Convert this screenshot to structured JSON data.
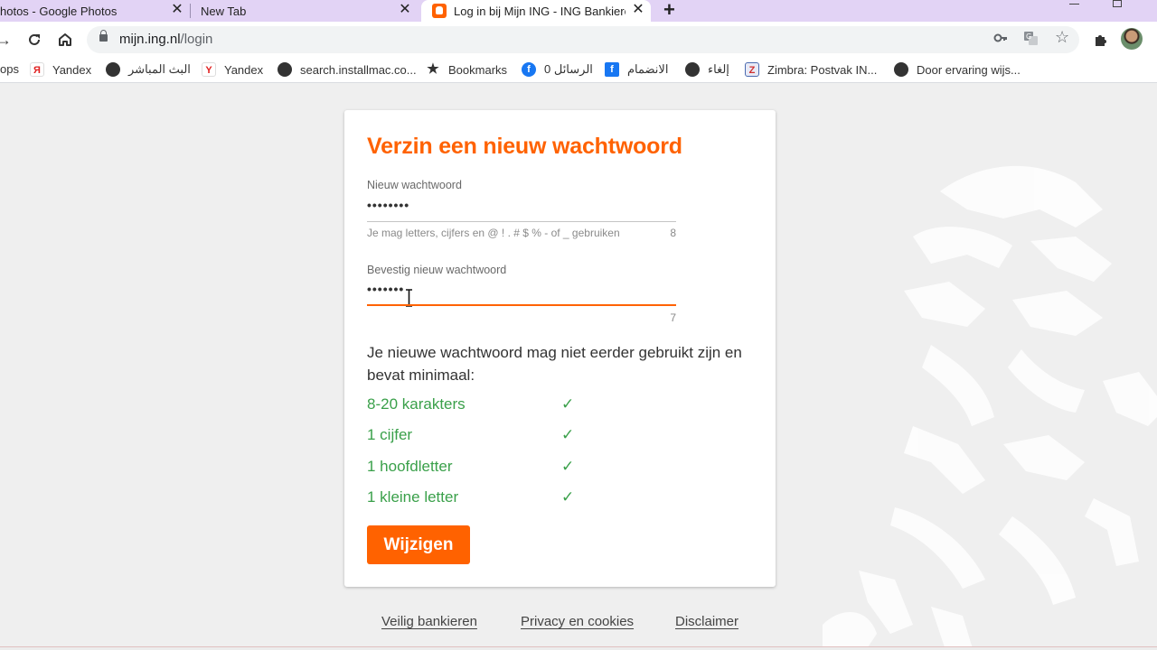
{
  "browser": {
    "tabs": [
      {
        "title": "hotos - Google Photos"
      },
      {
        "title": "New Tab"
      },
      {
        "title": "Log in bij Mijn ING - ING Bankieren"
      }
    ],
    "url_domain": "mijn.ing.nl",
    "url_path": "/login",
    "bookmarks": [
      {
        "label": "ops",
        "icon": "apps-icon"
      },
      {
        "label": "Yandex",
        "icon": "yandex-icon"
      },
      {
        "label": "البث المباشر",
        "icon": "globe-icon"
      },
      {
        "label": "Yandex",
        "icon": "yandex-icon"
      },
      {
        "label": "search.installmac.co...",
        "icon": "globe-icon"
      },
      {
        "label": "Bookmarks",
        "icon": "star-icon"
      },
      {
        "label": "0 الرسائل",
        "icon": "facebook-icon"
      },
      {
        "label": "الانضمام",
        "icon": "facebook-icon"
      },
      {
        "label": "إلغاء",
        "icon": "globe-icon"
      },
      {
        "label": "Zimbra: Postvak IN...",
        "icon": "zimbra-icon"
      },
      {
        "label": "Door ervaring wijs...",
        "icon": "globe-icon"
      }
    ]
  },
  "form": {
    "title": "Verzin een nieuw wachtwoord",
    "new_password": {
      "label": "Nieuw wachtwoord",
      "value": "••••••••",
      "hint": "Je mag letters, cijfers en @ ! . # $ % - of _ gebruiken",
      "count": "8"
    },
    "confirm_password": {
      "label": "Bevestig nieuw wachtwoord",
      "value": "•••••••",
      "count": "7"
    },
    "info": "Je nieuwe wachtwoord mag niet eerder gebruikt zijn en bevat minimaal:",
    "requirements": [
      {
        "label": "8-20 karakters",
        "check": "✓"
      },
      {
        "label": "1 cijfer",
        "check": "✓"
      },
      {
        "label": "1 hoofdletter",
        "check": "✓"
      },
      {
        "label": "1 kleine letter",
        "check": "✓"
      }
    ],
    "submit_label": "Wijzigen"
  },
  "footer": {
    "links": [
      "Veilig bankieren",
      "Privacy en cookies",
      "Disclaimer"
    ]
  },
  "colors": {
    "brand_orange": "#ff6200",
    "success_green": "#3aa04a",
    "tab_strip": "#e2d3f5"
  }
}
